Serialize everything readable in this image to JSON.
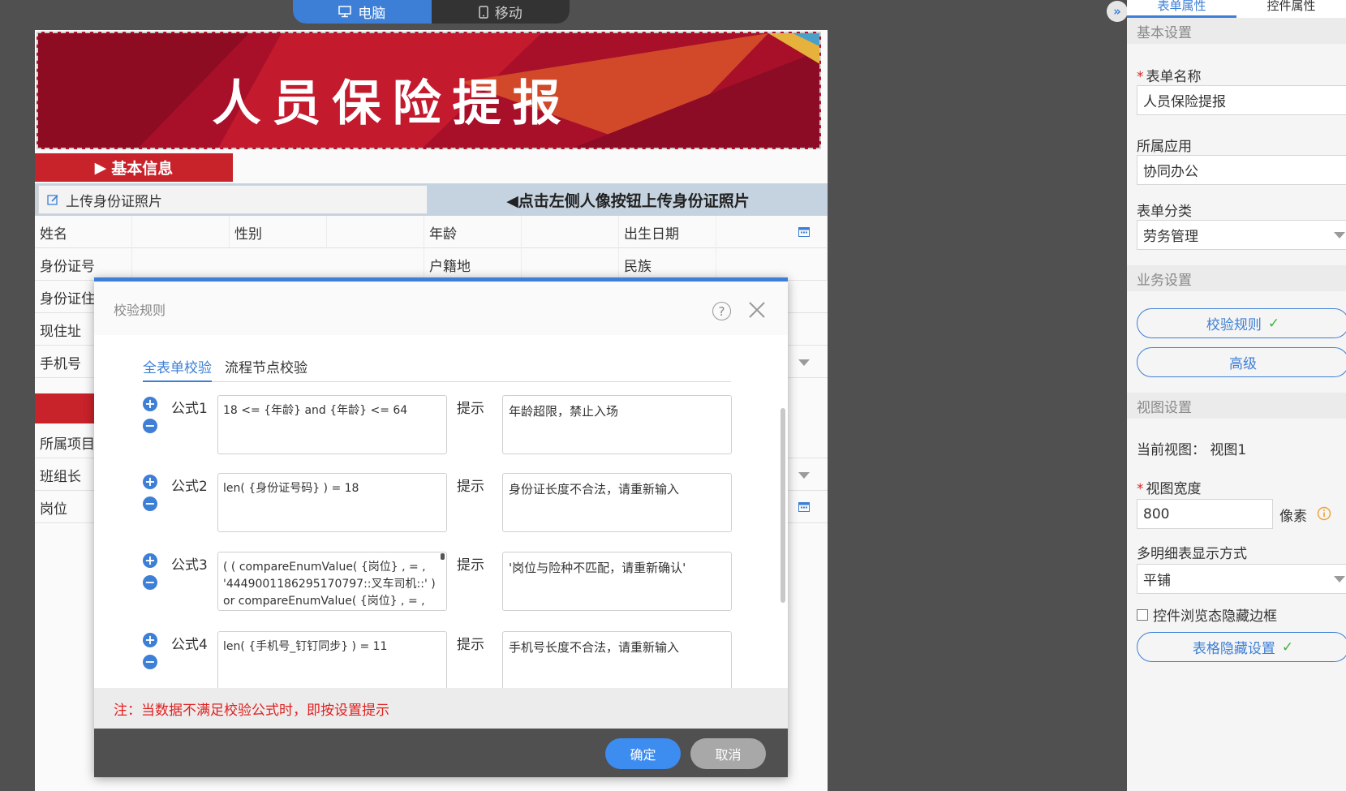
{
  "device_toggle": {
    "desktop": "电脑",
    "mobile": "移动"
  },
  "form": {
    "banner_title": "人员保险提报",
    "section_basic": "基本信息",
    "upload_button": "上传身份证照片",
    "upload_hint": "◀点击左侧人像按钮上传身份证照片",
    "labels": {
      "name": "姓名",
      "gender": "性别",
      "age": "年龄",
      "birth": "出生日期",
      "id_number": "身份证号",
      "hometown": "户籍地",
      "ethnicity": "民族",
      "id_address": "身份证住",
      "current_address": "现住址",
      "phone": "手机号",
      "project": "所属项目",
      "team_leader": "班组长",
      "post": "岗位"
    }
  },
  "modal": {
    "title": "校验规则",
    "tabs": [
      "全表单校验",
      "流程节点校验"
    ],
    "hint_label": "提示",
    "rules": [
      {
        "label": "公式1",
        "formula": "18  <=  {年龄}  and  {年龄}  <=  64",
        "hint": "年龄超限，禁止入场"
      },
      {
        "label": "公式2",
        "formula": "len( {身份证号码} )   =  18",
        "hint": "身份证长度不合法，请重新输入"
      },
      {
        "label": "公式3",
        "formula": "( (  compareEnumValue( {岗位} , = , '4449001186295170797::叉车司机::' )  or  compareEnumValue( {岗位} , = ,",
        "hint": "'岗位与险种不匹配，请重新确认'"
      },
      {
        "label": "公式4",
        "formula": "len( {手机号_钉钉同步} )   =  11",
        "hint": "手机号长度不合法，请重新输入"
      }
    ],
    "note": "注：当数据不满足校验公式时，即按设置提示",
    "ok": "确定",
    "cancel": "取消"
  },
  "panel": {
    "tabs": [
      "表单属性",
      "控件属性"
    ],
    "basic_settings": "基本设置",
    "form_name_label": "表单名称",
    "form_name": "人员保险提报",
    "app_label": "所属应用",
    "app": "协同办公",
    "category_label": "表单分类",
    "category": "劳务管理",
    "business_settings": "业务设置",
    "validation_button": "校验规则",
    "advanced_button": "高级",
    "view_settings": "视图设置",
    "current_view": "当前视图：  视图1",
    "view_width_label": "视图宽度",
    "view_width": "800",
    "unit": "像素",
    "detail_display_label": "多明细表显示方式",
    "detail_display": "平铺",
    "hide_border_label": "控件浏览态隐藏边框",
    "table_hide_button": "表格隐藏设置"
  },
  "colors": {
    "accent": "#3d7fd6",
    "banner_red": "#b3132a",
    "note_red": "#e02020",
    "check_green": "#3db33d"
  }
}
